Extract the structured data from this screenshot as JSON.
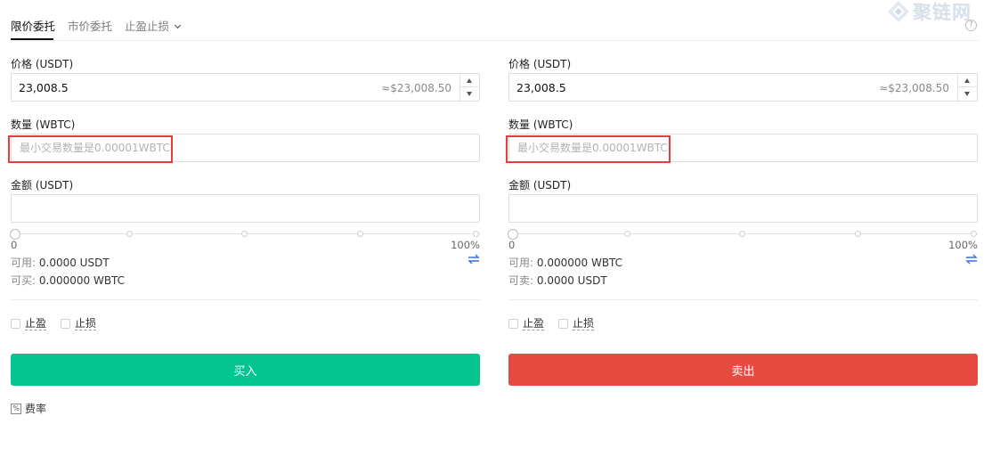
{
  "tabs": [
    {
      "label": "限价委托",
      "active": true
    },
    {
      "label": "市价委托",
      "active": false
    },
    {
      "label": "止盈止损",
      "active": false
    }
  ],
  "help_icon": "question-mark-icon",
  "watermark": {
    "text": "聚链网",
    "icon": "diamond-logo"
  },
  "buy": {
    "price_label": "价格 (USDT)",
    "price_value": "23,008.5",
    "price_approx": "≈$23,008.50",
    "qty_label": "数量 (WBTC)",
    "qty_placeholder": "最小交易数量是0.00001WBTC",
    "amount_label": "金额 (USDT)",
    "slider_min": "0",
    "slider_max": "100%",
    "slider_value": 0,
    "available_key": "可用:",
    "available_value": "0.0000 USDT",
    "can_key": "可买:",
    "can_value": "0.000000 WBTC",
    "take_profit": "止盈",
    "stop_loss": "止损",
    "button": "买入",
    "fee": "费率"
  },
  "sell": {
    "price_label": "价格 (USDT)",
    "price_value": "23,008.5",
    "price_approx": "≈$23,008.50",
    "qty_label": "数量 (WBTC)",
    "qty_placeholder": "最小交易数量是0.00001WBTC",
    "amount_label": "金额 (USDT)",
    "slider_min": "0",
    "slider_max": "100%",
    "slider_value": 0,
    "available_key": "可用:",
    "available_value": "0.000000 WBTC",
    "can_key": "可卖:",
    "can_value": "0.0000 USDT",
    "take_profit": "止盈",
    "stop_loss": "止损",
    "button": "卖出"
  },
  "colors": {
    "buy": "#06c48f",
    "sell": "#e64a41",
    "highlight": "#e43d3d",
    "transfer": "#3a6fd8"
  }
}
